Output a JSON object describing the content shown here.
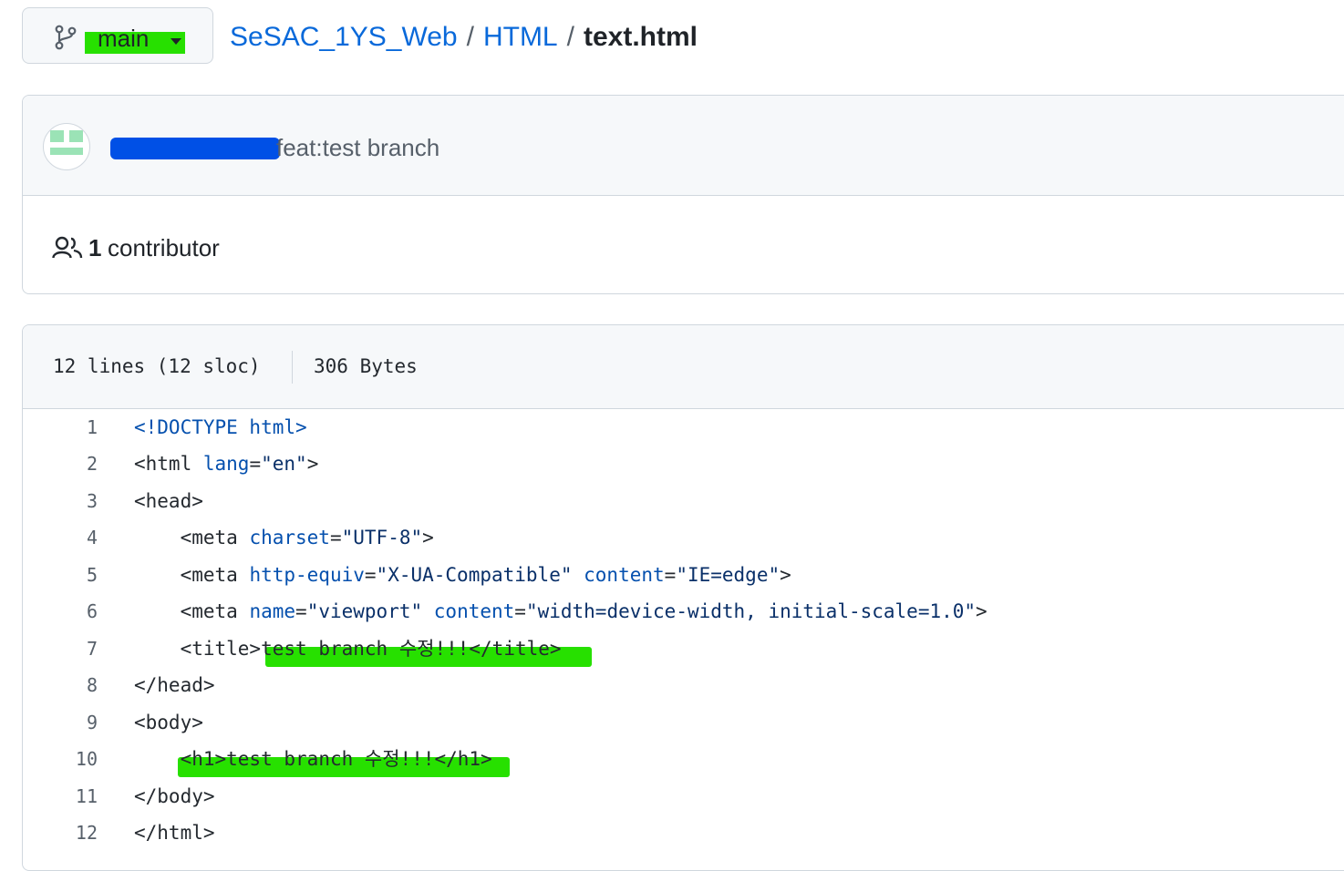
{
  "branch": {
    "label": "main"
  },
  "breadcrumb": {
    "repo": "SeSAC_1YS_Web",
    "folder": "HTML",
    "file": "text.html",
    "separator": "/"
  },
  "commit": {
    "message": "feat:test branch"
  },
  "contributors": {
    "count": "1",
    "label": "contributor"
  },
  "file_info": {
    "lines": "12 lines (12 sloc)",
    "size": "306 Bytes"
  },
  "code": {
    "line_numbers": [
      "1",
      "2",
      "3",
      "4",
      "5",
      "6",
      "7",
      "8",
      "9",
      "10",
      "11",
      "12"
    ],
    "lines": [
      "<!DOCTYPE html>",
      "<html lang=\"en\">",
      "<head>",
      "    <meta charset=\"UTF-8\">",
      "    <meta http-equiv=\"X-UA-Compatible\" content=\"IE=edge\">",
      "    <meta name=\"viewport\" content=\"width=device-width, initial-scale=1.0\">",
      "    <title>test branch 수정!!!</title>",
      "</head>",
      "<body>",
      "    <h1>test branch 수정!!!</h1>",
      "</body>",
      "</html>"
    ]
  },
  "colors": {
    "link": "#0969da",
    "highlight": "#27e000",
    "redaction": "#0050e6",
    "avatar_green": "#9be3b6",
    "tag": "#24292f",
    "attr": "#0550ae",
    "string": "#0a3069",
    "doctype": "#0550ae"
  },
  "icons": {
    "branch": "git-branch-icon",
    "caret": "triangle-down-icon",
    "people": "people-icon"
  }
}
